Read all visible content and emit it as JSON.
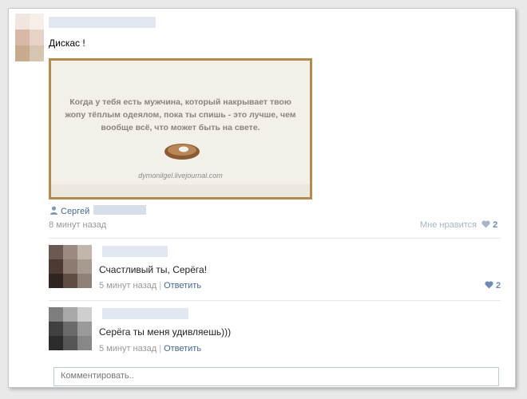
{
  "post": {
    "text": "Дискас !",
    "image_caption": "Когда у тебя есть мужчина, который накрывает твою жопу тёплым одеялом, пока ты спишь - это лучше, чем вообще всё, что может быть на свете.",
    "image_site": "dymonilgel.livejournal.com",
    "author": "Сергей",
    "time": "8 минут назад",
    "like_label": "Мне нравится",
    "like_count": "2"
  },
  "comments": [
    {
      "text": "Счастливый ты, Серёга!",
      "time": "5 минут назад",
      "reply_label": "Ответить",
      "like_count": "2"
    },
    {
      "text": "Серёга ты меня удивляешь)))",
      "time": "5 минут назад",
      "reply_label": "Ответить"
    }
  ],
  "comment_input": {
    "placeholder": "Комментировать.."
  },
  "icons": {
    "author": "person-icon",
    "like": "heart-icon"
  },
  "colors": {
    "link": "#45688e",
    "image_border": "#b38b4e",
    "like_heart": "#6d8bb0"
  }
}
